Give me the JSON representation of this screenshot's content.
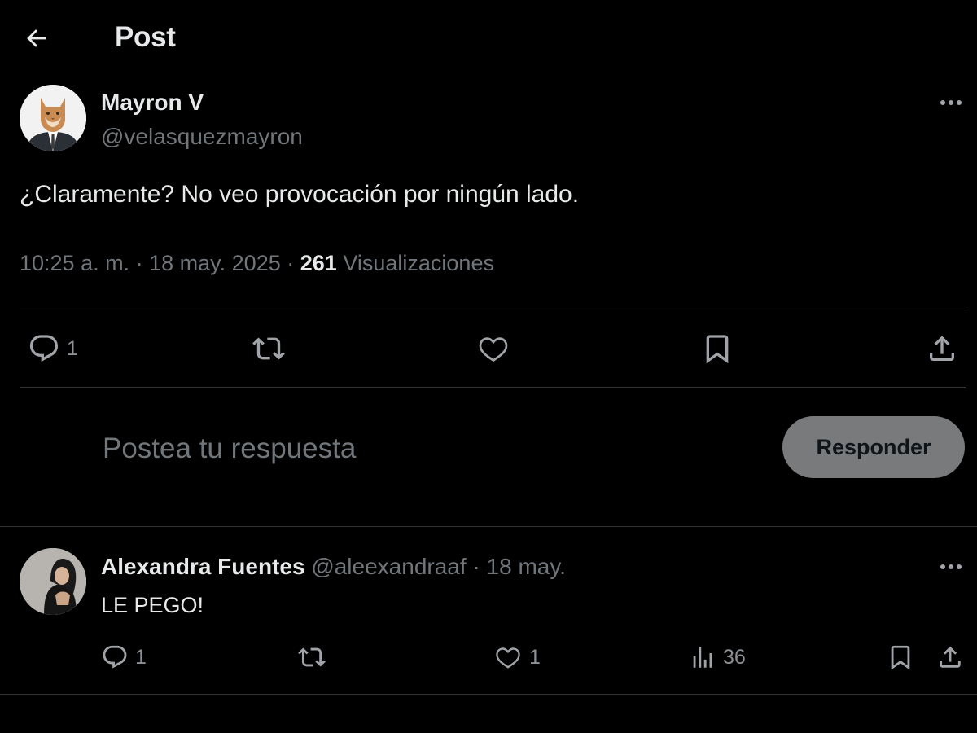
{
  "header": {
    "title": "Post"
  },
  "post": {
    "author_name": "Mayron V",
    "author_handle": "@velasquezmayron",
    "text": "¿Claramente? No veo provocación por ningún lado.",
    "time": "10:25 a. m.",
    "date": "18 may. 2025",
    "separator": "·",
    "views_count": "261",
    "views_label": "Visualizaciones",
    "actions": {
      "reply_count": "1",
      "repost_count": "",
      "like_count": ""
    }
  },
  "composer": {
    "placeholder": "Postea tu respuesta",
    "button_label": "Responder"
  },
  "reply": {
    "author_name": "Alexandra Fuentes",
    "author_handle": "@aleexandraaf",
    "separator": "·",
    "date": "18 may.",
    "text": "LE PEGO!",
    "actions": {
      "reply_count": "1",
      "repost_count": "",
      "like_count": "1",
      "views_count": "36"
    }
  },
  "icons": {
    "back": "arrow-left-icon",
    "more": "more-icon",
    "reply": "reply-icon",
    "repost": "repost-icon",
    "like": "heart-icon",
    "bookmark": "bookmark-icon",
    "share": "share-icon",
    "views": "views-icon"
  },
  "colors": {
    "background": "#000000",
    "text_primary": "#e7e9ea",
    "text_secondary": "#71767b",
    "divider": "#2f3336",
    "button_bg": "#787a7c"
  }
}
